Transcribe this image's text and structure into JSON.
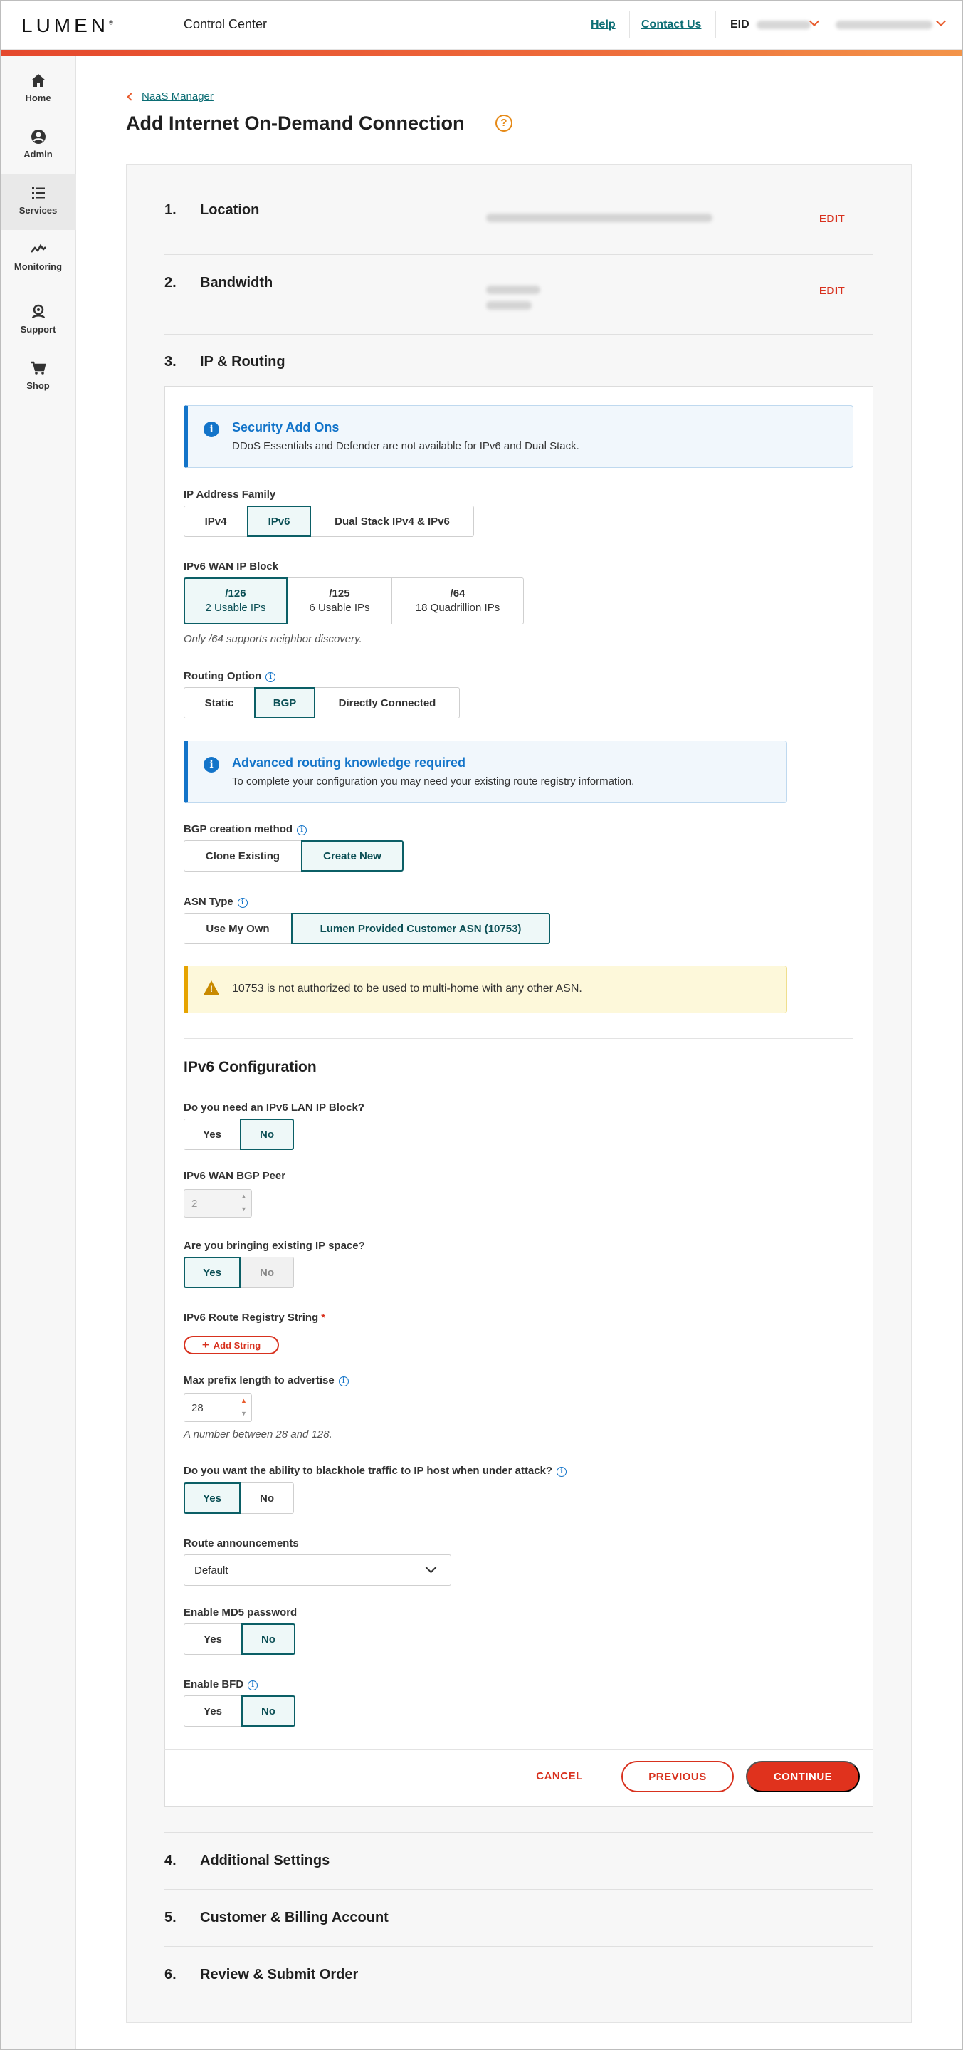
{
  "header": {
    "logo": "LUMEN",
    "logo_mark": "®",
    "app_title": "Control Center",
    "help": "Help",
    "contact_us": "Contact Us",
    "eid_label": "EID",
    "accent_color": "#e5482d"
  },
  "sidebar": {
    "items": [
      {
        "label": "Home",
        "icon": "home-icon"
      },
      {
        "label": "Admin",
        "icon": "user-icon"
      },
      {
        "label": "Services",
        "icon": "list-icon"
      },
      {
        "label": "Monitoring",
        "icon": "pulse-icon"
      },
      {
        "label": "Support",
        "icon": "support-icon"
      },
      {
        "label": "Shop",
        "icon": "cart-icon"
      }
    ]
  },
  "breadcrumb": "NaaS Manager",
  "page_title": "Add Internet On-Demand Connection",
  "help_glyph": "?",
  "steps": [
    {
      "num": "1.",
      "title": "Location",
      "edit": "EDIT"
    },
    {
      "num": "2.",
      "title": "Bandwidth",
      "edit": "EDIT"
    },
    {
      "num": "3.",
      "title": "IP & Routing"
    },
    {
      "num": "4.",
      "title": "Additional Settings"
    },
    {
      "num": "5.",
      "title": "Customer & Billing Account"
    },
    {
      "num": "6.",
      "title": "Review & Submit Order"
    }
  ],
  "security_info": {
    "title": "Security Add Ons",
    "text": "DDoS Essentials and Defender are not available for IPv6 and Dual Stack."
  },
  "ip_family": {
    "label": "IP Address Family",
    "options": [
      "IPv4",
      "IPv6",
      "Dual Stack IPv4 & IPv6"
    ],
    "selected": "IPv6"
  },
  "wan_block": {
    "label": "IPv6 WAN IP Block",
    "options": [
      {
        "prefix": "/126",
        "desc": "2 Usable IPs"
      },
      {
        "prefix": "/125",
        "desc": "6 Usable IPs"
      },
      {
        "prefix": "/64",
        "desc": "18 Quadrillion IPs"
      }
    ],
    "selected": "/126",
    "hint": "Only /64 supports neighbor discovery."
  },
  "routing": {
    "label": "Routing Option",
    "options": [
      "Static",
      "BGP",
      "Directly Connected"
    ],
    "selected": "BGP"
  },
  "routing_info": {
    "title": "Advanced routing knowledge required",
    "text": "To complete your configuration you may need your existing route registry information."
  },
  "bgp_method": {
    "label": "BGP creation method",
    "options": [
      "Clone Existing",
      "Create New"
    ],
    "selected": "Create New"
  },
  "asn_type": {
    "label": "ASN Type",
    "options": [
      "Use My Own",
      "Lumen Provided Customer ASN (10753)"
    ],
    "selected": "Lumen Provided Customer ASN (10753)"
  },
  "asn_warning": "10753 is not authorized to be used to multi-home with any other ASN.",
  "ipv6_config": {
    "title": "IPv6 Configuration",
    "lan_block": {
      "label": "Do you need an IPv6 LAN IP Block?",
      "options": [
        "Yes",
        "No"
      ],
      "selected": "No"
    },
    "wan_bgp_peer": {
      "label": "IPv6 WAN BGP Peer",
      "value": "2"
    },
    "existing_ip": {
      "label": "Are you bringing existing IP space?",
      "options": [
        "Yes",
        "No"
      ],
      "selected": "Yes"
    },
    "route_registry": {
      "label": "IPv6 Route Registry String",
      "required": "*",
      "add_button": "Add String"
    },
    "max_prefix": {
      "label": "Max prefix length to advertise",
      "value": "28",
      "hint": "A number between 28 and 128."
    },
    "blackhole": {
      "label": "Do you want the ability to blackhole traffic to IP host when under attack?",
      "options": [
        "Yes",
        "No"
      ],
      "selected": "Yes"
    },
    "route_announcements": {
      "label": "Route announcements",
      "value": "Default"
    },
    "md5": {
      "label": "Enable MD5 password",
      "options": [
        "Yes",
        "No"
      ],
      "selected": "No"
    },
    "bfd": {
      "label": "Enable BFD",
      "options": [
        "Yes",
        "No"
      ],
      "selected": "No"
    }
  },
  "actions": {
    "cancel": "CANCEL",
    "previous": "PREVIOUS",
    "continue": "CONTINUE"
  },
  "colors": {
    "teal": "#0b5f66",
    "red": "#d8311e",
    "info_blue": "#1374c9",
    "warn_yellow": "#e6a300"
  }
}
